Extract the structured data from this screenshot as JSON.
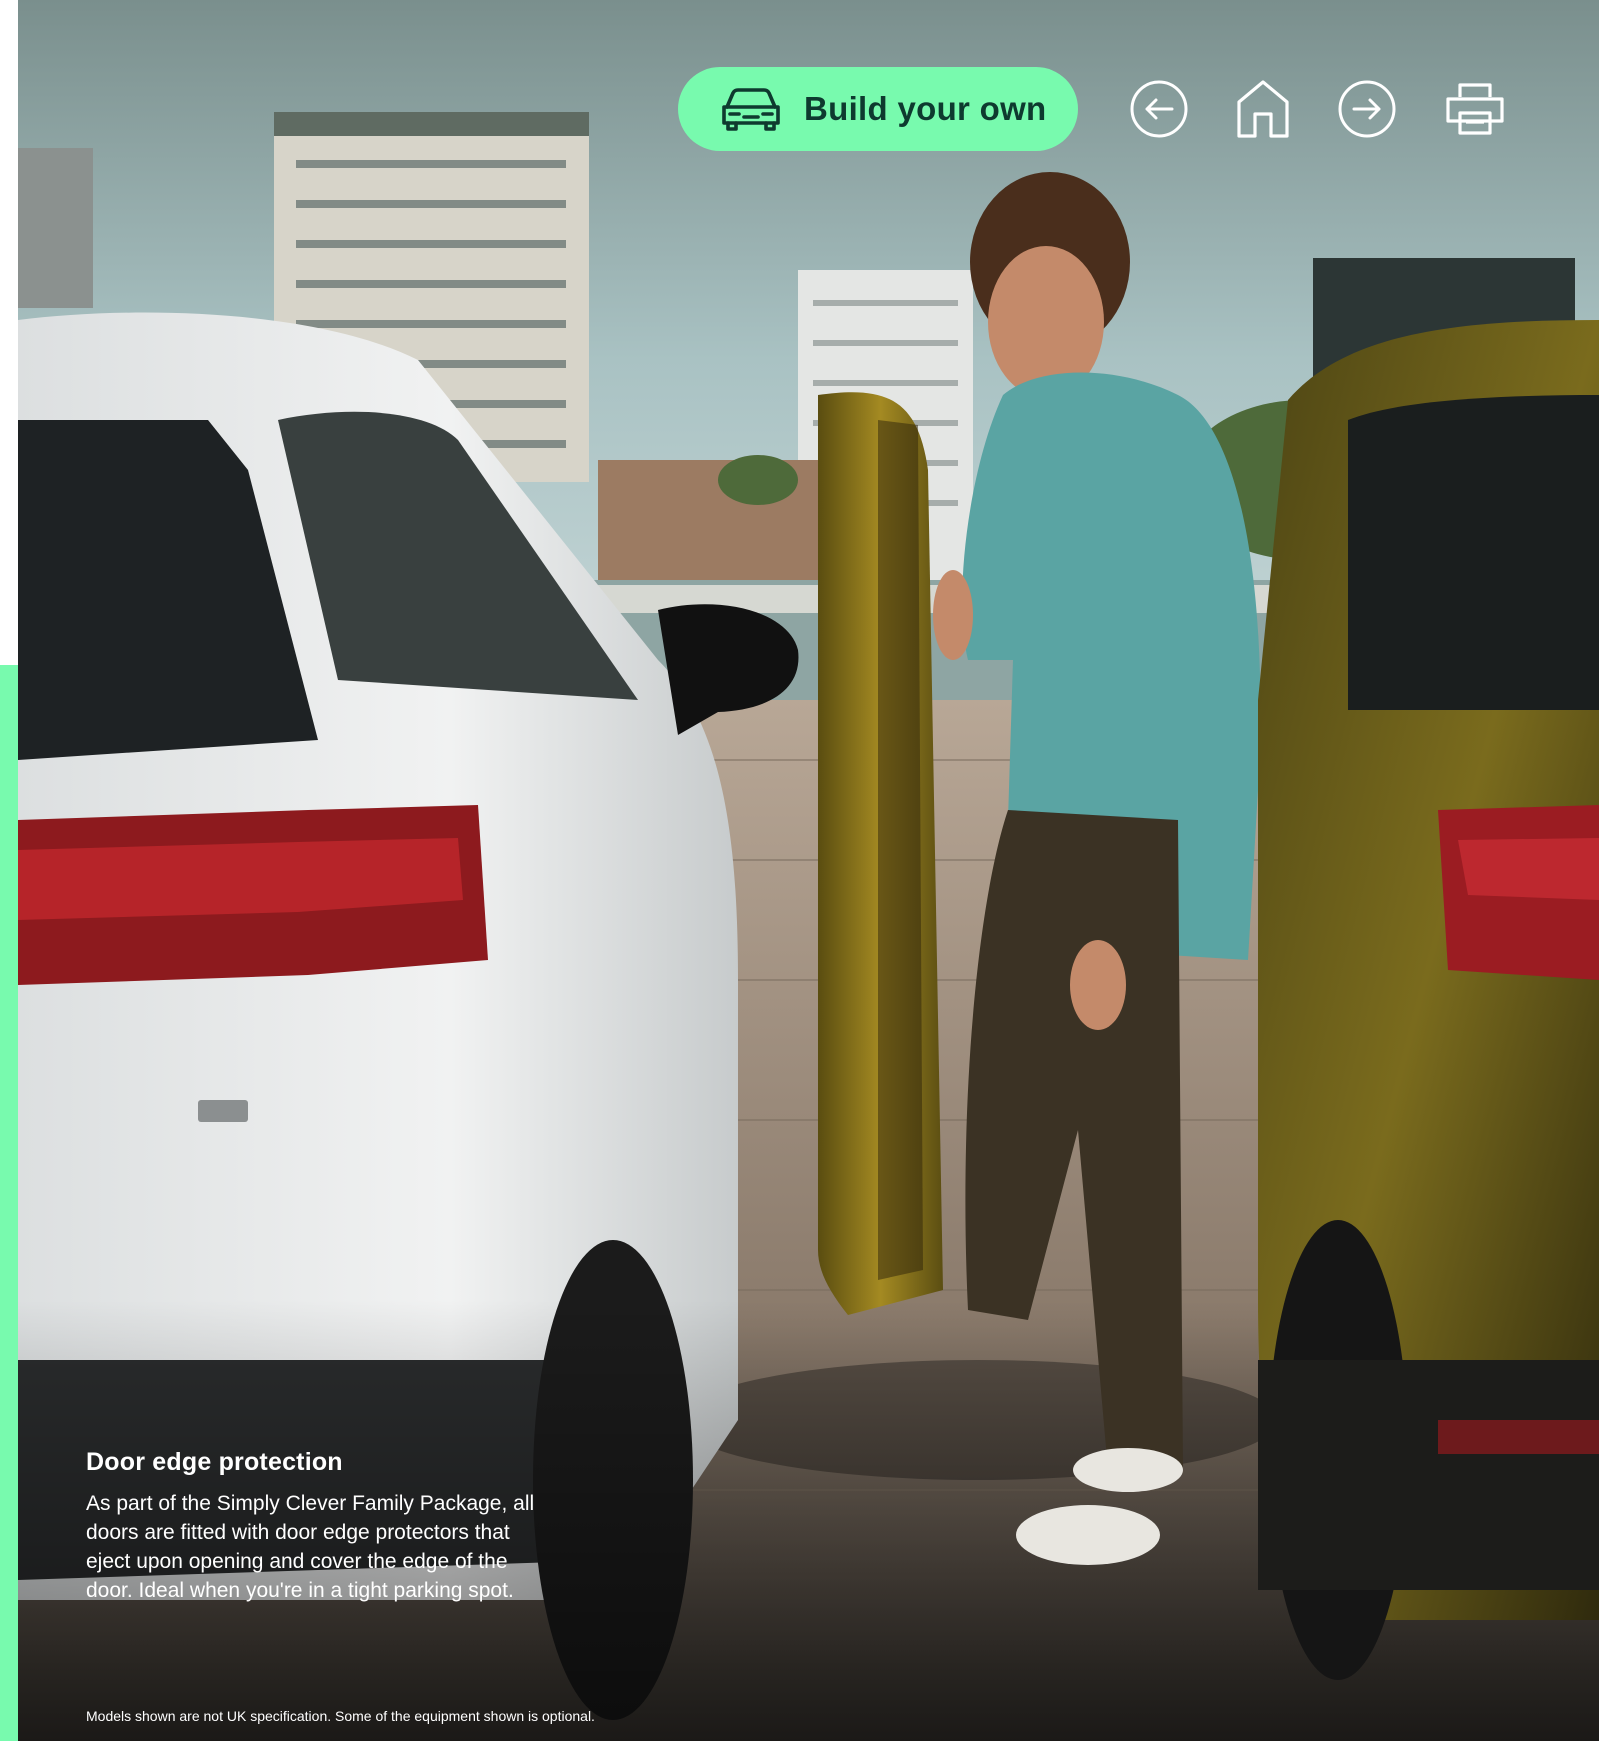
{
  "toolbar": {
    "build_label": "Build your own",
    "build_icon": "car-front-icon",
    "back_icon": "arrow-left-circle-icon",
    "home_icon": "home-icon",
    "forward_icon": "arrow-right-circle-icon",
    "print_icon": "printer-icon"
  },
  "feature": {
    "title": "Door edge protection",
    "description": "As part of the Simply Clever Family Package, all doors are fitted with door edge protectors that eject upon opening and cover the edge of the door. Ideal when you're in a tight parking spot."
  },
  "disclaimer": "Models shown are not UK specification. Some of the equipment shown is optional.",
  "colors": {
    "accent": "#78faae",
    "button_text": "#0e3a2f",
    "text_light": "#ffffff"
  }
}
